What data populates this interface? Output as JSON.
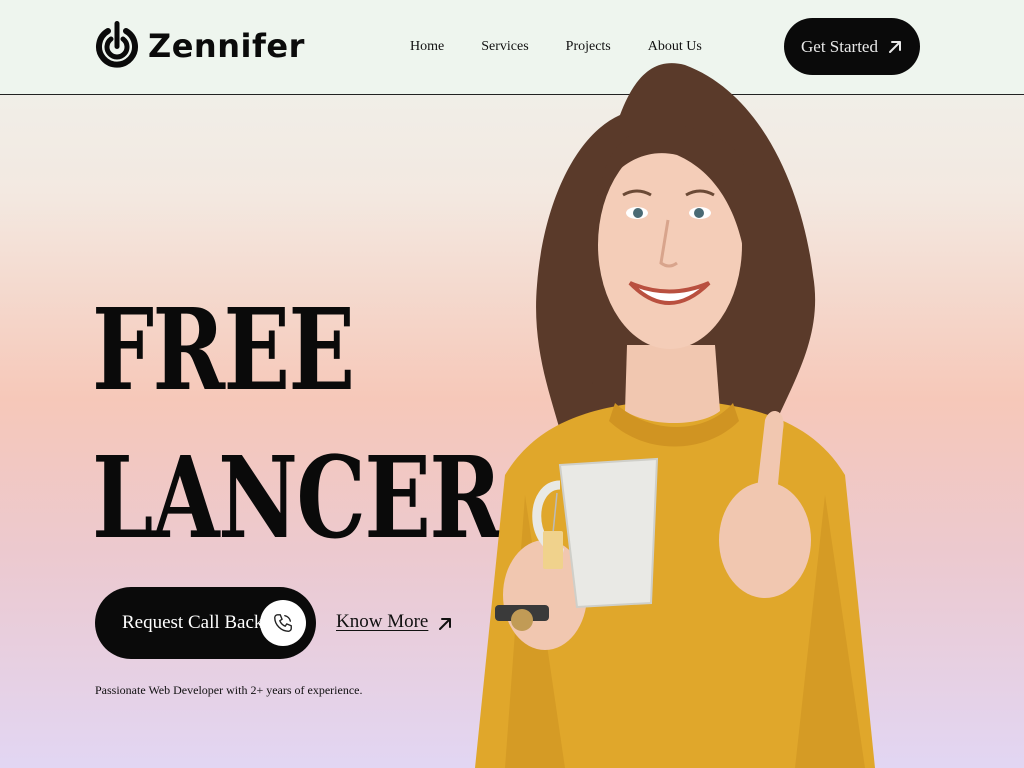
{
  "brand": {
    "name": "Zennifer",
    "logo_icon": "power-target-logo"
  },
  "nav": {
    "items": [
      {
        "label": "Home"
      },
      {
        "label": "Services"
      },
      {
        "label": "Projects"
      },
      {
        "label": "About Us"
      }
    ]
  },
  "header": {
    "cta_label": "Get Started",
    "cta_icon": "arrow-up-right-icon"
  },
  "hero": {
    "title_line1": "FREE",
    "title_line2": "LANCER",
    "primary_button_label": "Request Call Back",
    "primary_button_icon": "phone-icon",
    "secondary_link_label": "Know More",
    "secondary_link_icon": "arrow-up-right-icon",
    "tagline": "Passionate Web Developer with 2+ years of experience."
  },
  "colors": {
    "header_bg": "#eef5ee",
    "button_bg": "#0a0a0a",
    "sweater": "#e0a72b",
    "gradient_mid": "#f6c8b9",
    "gradient_bottom": "#e2d6f3"
  }
}
